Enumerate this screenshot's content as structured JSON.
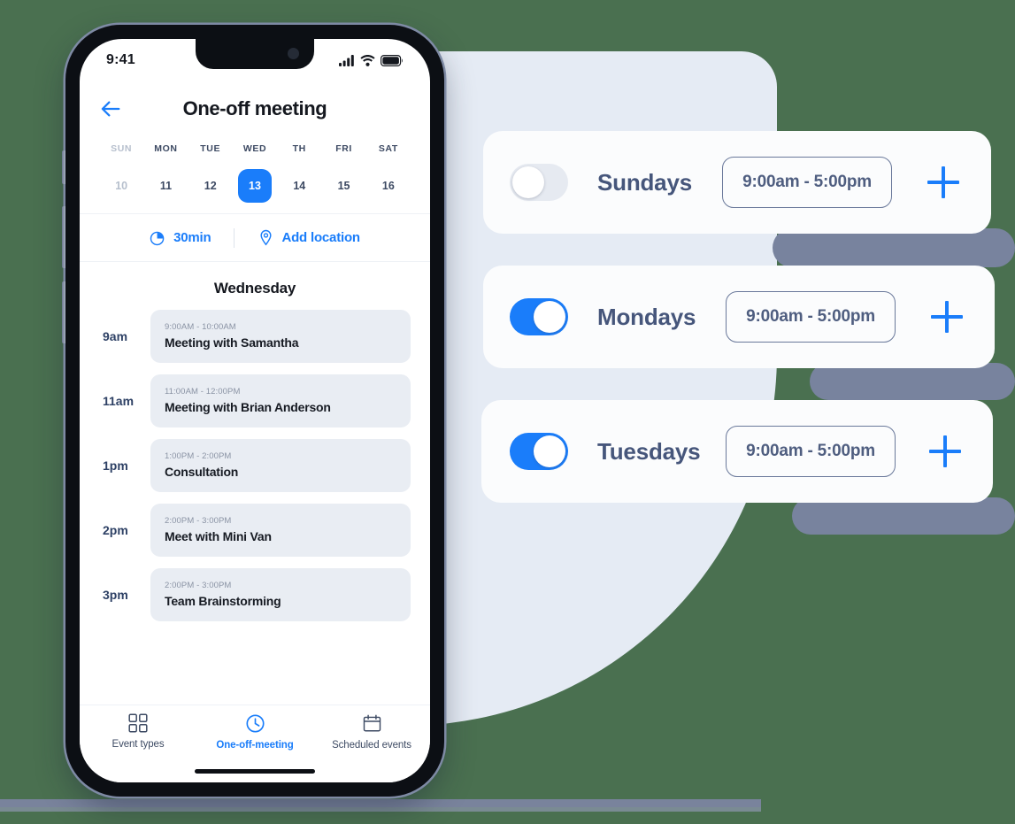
{
  "theme": {
    "page_bg": "#4a7050",
    "blob_bg": "#e5ebf4",
    "accent_blue": "#1a7dfa",
    "slate": "#46567b",
    "card_bg": "#fbfcfd",
    "event_card_bg": "#e9edf3",
    "shadow_slate": "#78839e"
  },
  "phone": {
    "status_bar": {
      "time": "9:41",
      "icons": [
        "signal-icon",
        "wifi-icon",
        "battery-icon"
      ]
    },
    "header": {
      "back_icon": "arrow-left-icon",
      "title": "One-off meeting"
    },
    "week_strip": [
      {
        "dow": "SUN",
        "date": "10",
        "state": "muted"
      },
      {
        "dow": "MON",
        "date": "11",
        "state": "normal"
      },
      {
        "dow": "TUE",
        "date": "12",
        "state": "normal"
      },
      {
        "dow": "WED",
        "date": "13",
        "state": "active"
      },
      {
        "dow": "TH",
        "date": "14",
        "state": "normal"
      },
      {
        "dow": "FRI",
        "date": "15",
        "state": "normal"
      },
      {
        "dow": "SAT",
        "date": "16",
        "state": "normal"
      }
    ],
    "action_bar": [
      {
        "icon": "clock-icon",
        "label": "30min"
      },
      {
        "icon": "location-pin-icon",
        "label": "Add location"
      }
    ],
    "day_heading": "Wednesday",
    "events": [
      {
        "hour": "9am",
        "time": "9:00AM - 10:00AM",
        "title": "Meeting with Samantha"
      },
      {
        "hour": "11am",
        "time": "11:00AM - 12:00PM",
        "title": "Meeting with Brian Anderson"
      },
      {
        "hour": "1pm",
        "time": "1:00PM - 2:00PM",
        "title": "Consultation"
      },
      {
        "hour": "2pm",
        "time": "2:00PM - 3:00PM",
        "title": "Meet with Mini Van"
      },
      {
        "hour": "3pm",
        "time": "2:00PM - 3:00PM",
        "title": "Team Brainstorming"
      }
    ],
    "tabs": [
      {
        "icon": "grid-icon",
        "label": "Event types",
        "active": false
      },
      {
        "icon": "clock-icon",
        "label": "One-off-meeting",
        "active": true
      },
      {
        "icon": "calendar-icon",
        "label": "Scheduled events",
        "active": false
      }
    ]
  },
  "availability": {
    "cards": [
      {
        "day": "Sundays",
        "enabled": false,
        "time_range": "9:00am - 5:00pm",
        "add_icon": "plus-icon"
      },
      {
        "day": "Mondays",
        "enabled": true,
        "time_range": "9:00am - 5:00pm",
        "add_icon": "plus-icon"
      },
      {
        "day": "Tuesdays",
        "enabled": true,
        "time_range": "9:00am - 5:00pm",
        "add_icon": "plus-icon"
      }
    ]
  }
}
